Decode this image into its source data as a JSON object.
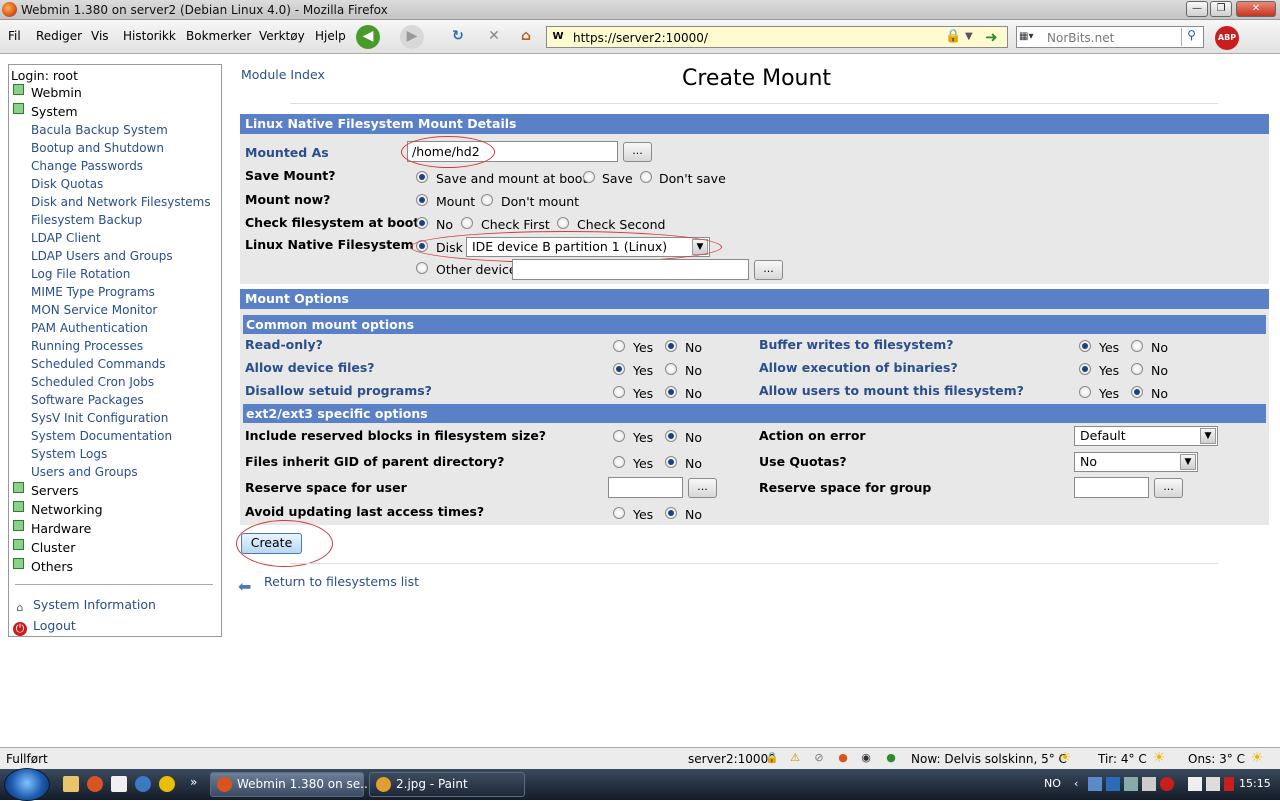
{
  "window": {
    "title": "Webmin 1.380 on server2 (Debian Linux 4.0) - Mozilla Firefox"
  },
  "menu": [
    "Fil",
    "Rediger",
    "Vis",
    "Historikk",
    "Bokmerker",
    "Verktøy",
    "Hjelp"
  ],
  "address": {
    "url": "https://server2:10000/"
  },
  "search": {
    "placeholder": "NorBits.net"
  },
  "sidebar": {
    "login": "Login: root",
    "categories": {
      "webmin": "Webmin",
      "system": "System",
      "servers": "Servers",
      "networking": "Networking",
      "hardware": "Hardware",
      "cluster": "Cluster",
      "others": "Others"
    },
    "system_items": [
      "Bacula Backup System",
      "Bootup and Shutdown",
      "Change Passwords",
      "Disk Quotas",
      "Disk and Network Filesystems",
      "Filesystem Backup",
      "LDAP Client",
      "LDAP Users and Groups",
      "Log File Rotation",
      "MIME Type Programs",
      "MON Service Monitor",
      "PAM Authentication",
      "Running Processes",
      "Scheduled Commands",
      "Scheduled Cron Jobs",
      "Software Packages",
      "SysV Init Configuration",
      "System Documentation",
      "System Logs",
      "Users and Groups"
    ],
    "system_info": "System Information",
    "logout": "Logout"
  },
  "page": {
    "module_index": "Module Index",
    "title": "Create Mount",
    "details_header": "Linux Native Filesystem Mount Details",
    "mounted_as_label": "Mounted As",
    "mounted_as_value": "/home/hd2",
    "browse": "...",
    "save_mount_label": "Save Mount?",
    "save_opts": [
      "Save and mount at boot",
      "Save",
      "Don't save"
    ],
    "mount_now_label": "Mount now?",
    "mount_opts": [
      "Mount",
      "Don't mount"
    ],
    "check_label": "Check filesystem at boot?",
    "check_opts": [
      "No",
      "Check First",
      "Check Second"
    ],
    "fs_label": "Linux Native Filesystem",
    "disk_label": "Disk",
    "disk_value": "IDE device B partition 1 (Linux)",
    "other_device_label": "Other device",
    "mount_options_header": "Mount Options",
    "common_header": "Common mount options",
    "ext_header": "ext2/ext3 specific options",
    "yes": "Yes",
    "no": "No",
    "read_only": "Read-only?",
    "buffer_writes": "Buffer writes to filesystem?",
    "allow_device": "Allow device files?",
    "allow_exec": "Allow execution of binaries?",
    "disallow_setuid": "Disallow setuid programs?",
    "allow_users": "Allow users to mount this filesystem?",
    "include_reserved": "Include reserved blocks in filesystem size?",
    "action_on_error": "Action on error",
    "action_value": "Default",
    "inherit_gid": "Files inherit GID of parent directory?",
    "use_quotas": "Use Quotas?",
    "quotas_value": "No",
    "reserve_user": "Reserve space for user",
    "reserve_group": "Reserve space for group",
    "avoid_atime": "Avoid updating last access times?",
    "create_button": "Create",
    "return_link": "Return to filesystems list"
  },
  "statusbar": {
    "status": "Fullført",
    "host": "server2:10000",
    "weather_now": "Now: Delvis solskinn, 5° C",
    "weather_tue": "Tir: 4° C",
    "weather_wed": "Ons: 3° C"
  },
  "taskbar": {
    "task1": "Webmin 1.380 on se...",
    "task2": "2.jpg - Paint",
    "lang": "NO",
    "clock": "15:15"
  }
}
